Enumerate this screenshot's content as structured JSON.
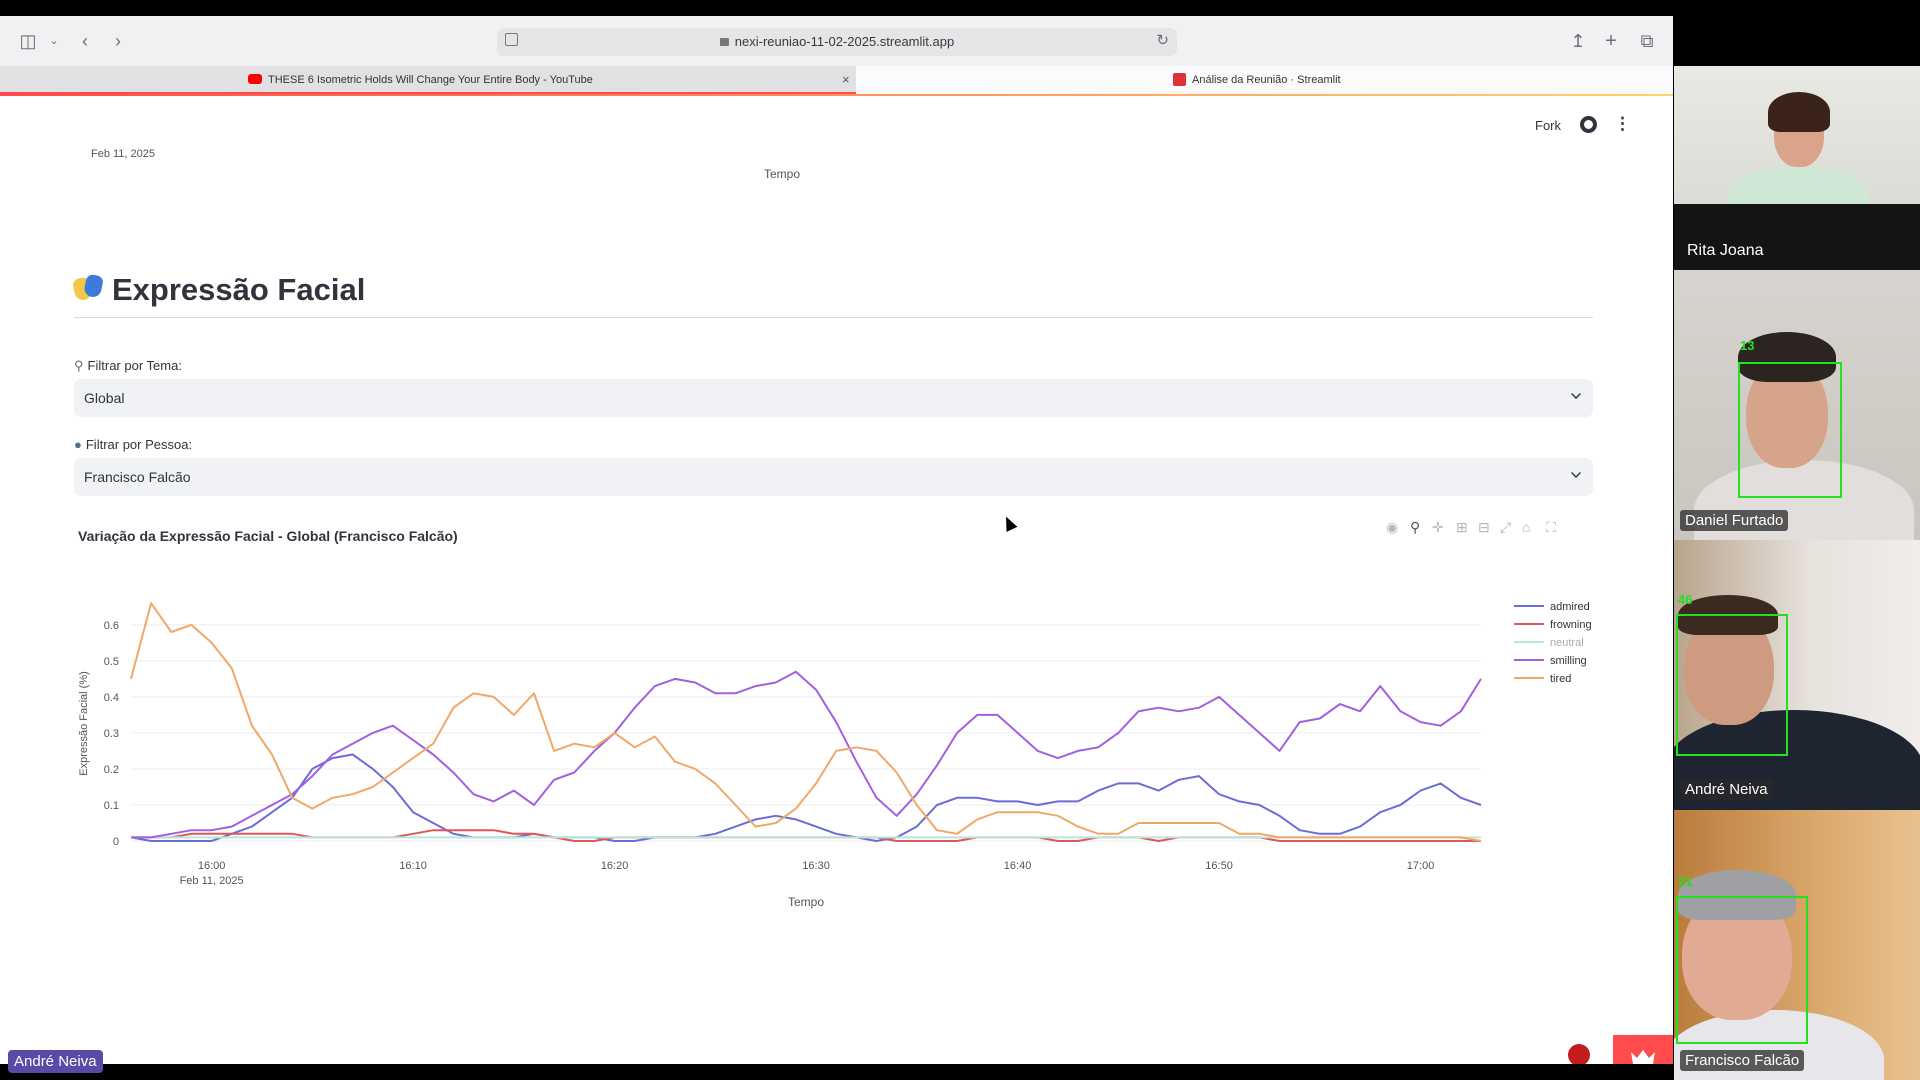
{
  "browser": {
    "url": "nexi-reuniao-11-02-2025.streamlit.app",
    "tabs": [
      {
        "label": "THESE 6 Isometric Holds Will Change Your Entire Body - YouTube"
      },
      {
        "label": "Análise da Reunião · Streamlit"
      }
    ]
  },
  "header": {
    "fork_label": "Fork"
  },
  "previous_chart": {
    "date_label": "Feb 11, 2025",
    "axis_title": "Tempo"
  },
  "section": {
    "title": "Expressão Facial"
  },
  "filters": {
    "theme_label": "Filtrar por Tema:",
    "theme_value": "Global",
    "person_label": "Filtrar por Pessoa:",
    "person_value": "Francisco Falcão"
  },
  "chart_title": "Variação da Expressão Facial - Global (Francisco Falcão)",
  "chart_data": {
    "type": "line",
    "title": "Variação da Expressão Facial - Global (Francisco Falcão)",
    "xlabel": "Tempo",
    "ylabel": "Expressão Facial (%)",
    "ylim": [
      0,
      0.68
    ],
    "yticks": [
      0,
      0.1,
      0.2,
      0.3,
      0.4,
      0.5,
      0.6
    ],
    "ytick_labels": [
      "0",
      "0.1",
      "0.2",
      "0.3",
      "0.4",
      "0.5",
      "0.6"
    ],
    "xlim": [
      "15:56",
      "17:03"
    ],
    "xticks": [
      "16:00",
      "16:10",
      "16:20",
      "16:30",
      "16:40",
      "16:50",
      "17:00"
    ],
    "x_date_label": "Feb 11, 2025",
    "legend_title": "Expressão Facial",
    "legend_position": "top-right",
    "grid": true,
    "x": [
      "15:56",
      "15:57",
      "15:58",
      "15:59",
      "16:00",
      "16:01",
      "16:02",
      "16:03",
      "16:04",
      "16:05",
      "16:06",
      "16:07",
      "16:08",
      "16:09",
      "16:10",
      "16:11",
      "16:12",
      "16:13",
      "16:14",
      "16:15",
      "16:16",
      "16:17",
      "16:18",
      "16:19",
      "16:20",
      "16:21",
      "16:22",
      "16:23",
      "16:24",
      "16:25",
      "16:26",
      "16:27",
      "16:28",
      "16:29",
      "16:30",
      "16:31",
      "16:32",
      "16:33",
      "16:34",
      "16:35",
      "16:36",
      "16:37",
      "16:38",
      "16:39",
      "16:40",
      "16:41",
      "16:42",
      "16:43",
      "16:44",
      "16:45",
      "16:46",
      "16:47",
      "16:48",
      "16:49",
      "16:50",
      "16:51",
      "16:52",
      "16:53",
      "16:54",
      "16:55",
      "16:56",
      "16:57",
      "16:58",
      "16:59",
      "17:00",
      "17:01",
      "17:02",
      "17:03"
    ],
    "series": [
      {
        "name": "admired",
        "color": "#6b6cd8",
        "values": [
          0.01,
          0.0,
          0.0,
          0.0,
          0.0,
          0.02,
          0.04,
          0.08,
          0.12,
          0.2,
          0.23,
          0.24,
          0.2,
          0.15,
          0.08,
          0.05,
          0.02,
          0.01,
          0.01,
          0.01,
          0.02,
          0.01,
          0.01,
          0.01,
          0.0,
          0.0,
          0.01,
          0.01,
          0.01,
          0.02,
          0.04,
          0.06,
          0.07,
          0.06,
          0.04,
          0.02,
          0.01,
          0.0,
          0.01,
          0.04,
          0.1,
          0.12,
          0.12,
          0.11,
          0.11,
          0.1,
          0.11,
          0.11,
          0.14,
          0.16,
          0.16,
          0.14,
          0.17,
          0.18,
          0.13,
          0.11,
          0.1,
          0.07,
          0.03,
          0.02,
          0.02,
          0.04,
          0.08,
          0.1,
          0.14,
          0.16,
          0.12,
          0.1
        ]
      },
      {
        "name": "frowning",
        "color": "#e05656",
        "values": [
          0.01,
          0.01,
          0.01,
          0.02,
          0.02,
          0.02,
          0.02,
          0.02,
          0.02,
          0.01,
          0.01,
          0.01,
          0.01,
          0.01,
          0.02,
          0.03,
          0.03,
          0.03,
          0.03,
          0.02,
          0.02,
          0.01,
          0.0,
          0.0,
          0.01,
          0.01,
          0.01,
          0.01,
          0.01,
          0.01,
          0.01,
          0.01,
          0.01,
          0.01,
          0.01,
          0.01,
          0.01,
          0.01,
          0.0,
          0.0,
          0.0,
          0.0,
          0.01,
          0.01,
          0.01,
          0.01,
          0.0,
          0.0,
          0.01,
          0.01,
          0.01,
          0.0,
          0.01,
          0.01,
          0.01,
          0.01,
          0.01,
          0.0,
          0.0,
          0.0,
          0.0,
          0.0,
          0.0,
          0.0,
          0.0,
          0.0,
          0.0,
          0.0
        ]
      },
      {
        "name": "neutral",
        "color": "#b9e6dc",
        "values": [
          0.01,
          0.01,
          0.01,
          0.01,
          0.01,
          0.01,
          0.01,
          0.01,
          0.01,
          0.01,
          0.01,
          0.01,
          0.01,
          0.01,
          0.01,
          0.01,
          0.01,
          0.01,
          0.01,
          0.01,
          0.01,
          0.01,
          0.01,
          0.01,
          0.01,
          0.01,
          0.01,
          0.01,
          0.01,
          0.01,
          0.01,
          0.01,
          0.01,
          0.01,
          0.01,
          0.01,
          0.01,
          0.01,
          0.01,
          0.01,
          0.01,
          0.01,
          0.01,
          0.01,
          0.01,
          0.01,
          0.01,
          0.01,
          0.01,
          0.01,
          0.01,
          0.01,
          0.01,
          0.01,
          0.01,
          0.01,
          0.01,
          0.01,
          0.01,
          0.01,
          0.01,
          0.01,
          0.01,
          0.01,
          0.01,
          0.01,
          0.01,
          0.01
        ]
      },
      {
        "name": "smilling",
        "color": "#a25fe0",
        "values": [
          0.01,
          0.01,
          0.02,
          0.03,
          0.03,
          0.04,
          0.07,
          0.1,
          0.13,
          0.18,
          0.24,
          0.27,
          0.3,
          0.32,
          0.28,
          0.24,
          0.19,
          0.13,
          0.11,
          0.14,
          0.1,
          0.17,
          0.19,
          0.25,
          0.3,
          0.37,
          0.43,
          0.45,
          0.44,
          0.41,
          0.41,
          0.43,
          0.44,
          0.47,
          0.42,
          0.33,
          0.22,
          0.12,
          0.07,
          0.13,
          0.21,
          0.3,
          0.35,
          0.35,
          0.3,
          0.25,
          0.23,
          0.25,
          0.26,
          0.3,
          0.36,
          0.37,
          0.36,
          0.37,
          0.4,
          0.35,
          0.3,
          0.25,
          0.33,
          0.34,
          0.38,
          0.36,
          0.43,
          0.36,
          0.33,
          0.32,
          0.36,
          0.45
        ]
      },
      {
        "name": "tired",
        "color": "#f0a868",
        "values": [
          0.45,
          0.66,
          0.58,
          0.6,
          0.55,
          0.48,
          0.32,
          0.24,
          0.12,
          0.09,
          0.12,
          0.13,
          0.15,
          0.19,
          0.23,
          0.27,
          0.37,
          0.41,
          0.4,
          0.35,
          0.41,
          0.25,
          0.27,
          0.26,
          0.3,
          0.26,
          0.29,
          0.22,
          0.2,
          0.16,
          0.1,
          0.04,
          0.05,
          0.09,
          0.16,
          0.25,
          0.26,
          0.25,
          0.19,
          0.1,
          0.03,
          0.02,
          0.06,
          0.08,
          0.08,
          0.08,
          0.07,
          0.04,
          0.02,
          0.02,
          0.05,
          0.05,
          0.05,
          0.05,
          0.05,
          0.02,
          0.02,
          0.01,
          0.01,
          0.01,
          0.01,
          0.01,
          0.01,
          0.01,
          0.01,
          0.01,
          0.01,
          0.0
        ]
      }
    ]
  },
  "participants": [
    {
      "name": "Rita Joana"
    },
    {
      "name": "Daniel Furtado",
      "face_id": "13"
    },
    {
      "name": "André Neiva",
      "face_id": "46"
    },
    {
      "name": "Francisco Falcão",
      "face_id": "21"
    }
  ],
  "self_view_name": "André Neiva"
}
